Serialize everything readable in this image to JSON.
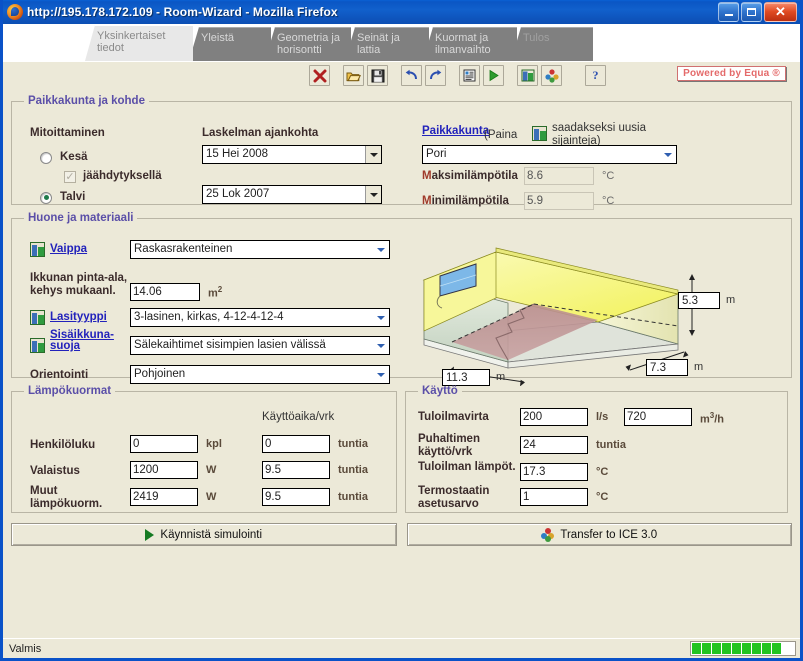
{
  "window": {
    "title": "http://195.178.172.109 - Room-Wizard - Mozilla Firefox",
    "minimize_label": "_",
    "maximize_label": "□",
    "close_label": "✕"
  },
  "tabs": [
    {
      "label": "Yksinkertaiset tiedot",
      "state": "active"
    },
    {
      "label": "Yleistä",
      "state": "normal"
    },
    {
      "label": "Geometria ja horisontti",
      "state": "normal"
    },
    {
      "label": "Seinät ja lattia",
      "state": "normal"
    },
    {
      "label": "Kuormat ja ilmanvaihto",
      "state": "normal"
    },
    {
      "label": "Tulos",
      "state": "disabled"
    }
  ],
  "toolbar": {
    "buttons": [
      {
        "name": "delete-icon",
        "glyph": "✖"
      },
      {
        "name": "open-folder-icon",
        "glyph": "📂"
      },
      {
        "name": "save-disk-icon",
        "glyph": "💾"
      },
      {
        "name": "undo-icon",
        "glyph": "↩"
      },
      {
        "name": "redo-icon",
        "glyph": "↪"
      },
      {
        "name": "report-icon",
        "glyph": "▤"
      },
      {
        "name": "run-play-icon",
        "glyph": "▶"
      },
      {
        "name": "database-icon",
        "glyph": "▥"
      },
      {
        "name": "settings-balls-icon",
        "glyph": "❖"
      },
      {
        "name": "help-icon",
        "glyph": "?"
      }
    ],
    "badge": "Powered by Equa ®"
  },
  "location_group": {
    "legend": "Paikkakunta ja kohde",
    "sizing_label": "Mitoittaminen",
    "date_label": "Laskelman ajankohta",
    "summer_label": "Kesä",
    "summer_selected": false,
    "cooling_label": "jäähdytyksellä",
    "cooling_checked": true,
    "winter_label": "Talvi",
    "winter_selected": true,
    "summer_date": "15 Hei 2008",
    "winter_date": "25 Lok 2007",
    "place_link": "Paikkakunta",
    "place_hint_pre": "(Paina",
    "place_hint_post": "saadakseksi uusia sijainteja)",
    "place_value": "Pori",
    "max_temp_label_first": "M",
    "max_temp_label_rest": "aksimilämpötila",
    "max_temp_value": "8.6",
    "min_temp_label_first": "M",
    "min_temp_label_rest": "inimilämpötila",
    "min_temp_value": "5.9",
    "temp_unit": "°C"
  },
  "room_group": {
    "legend": "Huone ja materiaali",
    "envelope_link": "Vaippa",
    "envelope_value": "Raskasrakenteinen",
    "window_area_label_l1": "Ikkunan pinta-ala,",
    "window_area_label_l2": "kehys mukaanl.",
    "window_area_value": "14.06",
    "window_area_unit": "m",
    "window_area_unit_sup": "2",
    "glazing_link": "Lasityyppi",
    "glazing_value": "3-lasinen, kirkas, 4-12-4-12-4",
    "shading_link_l1": "Sisäikkuna-",
    "shading_link_l2": "suoja",
    "shading_value": "Sälekaihtimet sisimpien lasien välissä",
    "orientation_label": "Orientointi",
    "orientation_value": "Pohjoinen",
    "dim_height": "5.3",
    "dim_height_unit": "m",
    "dim_depth": "7.3",
    "dim_depth_unit": "m",
    "dim_width": "11.3",
    "dim_width_unit": "m"
  },
  "loads_group": {
    "legend": "Lämpökuormat",
    "usage_header": "Käyttöaika/vrk",
    "rows": [
      {
        "label_l1": "Henkilöluku",
        "label_l2": "",
        "value": "0",
        "unit": "kpl",
        "hours": "0",
        "hours_unit": "tuntia"
      },
      {
        "label_l1": "Valaistus",
        "label_l2": "",
        "value": "1200",
        "unit": "W",
        "hours": "9.5",
        "hours_unit": "tuntia"
      },
      {
        "label_l1": "Muut",
        "label_l2": "lämpökuorm.",
        "value": "2419",
        "unit": "W",
        "hours": "9.5",
        "hours_unit": "tuntia"
      }
    ]
  },
  "usage_group": {
    "legend": "Käyttö",
    "supply_air_label": "Tuloilmavirta",
    "supply_air_value": "200",
    "supply_air_unit": "l/s",
    "supply_air_value2": "720",
    "supply_air_unit2_base": "m",
    "supply_air_unit2_sup": "3",
    "supply_air_unit2_tail": "/h",
    "fan_label_l1": "Puhaltimen",
    "fan_label_l2": "käyttö/vrk",
    "fan_value": "24",
    "fan_unit": "tuntia",
    "supply_temp_label": "Tuloilman lämpöt.",
    "supply_temp_value": "17.3",
    "supply_temp_unit": "°C",
    "thermostat_label_l1": "Termostaatin",
    "thermostat_label_l2": "asetusarvo",
    "thermostat_value": "1",
    "thermostat_unit": "°C"
  },
  "actions": {
    "run_label": "Käynnistä simulointi",
    "transfer_label": "Transfer to ICE 3.0"
  },
  "statusbar": {
    "text": "Valmis",
    "progress_blocks": 9
  },
  "colors": {
    "accent_legend": "#5b4fa8",
    "link": "#2222bb",
    "titlebar": "#0a52c8",
    "panel": "#ece9d8",
    "progress": "#21c421"
  }
}
